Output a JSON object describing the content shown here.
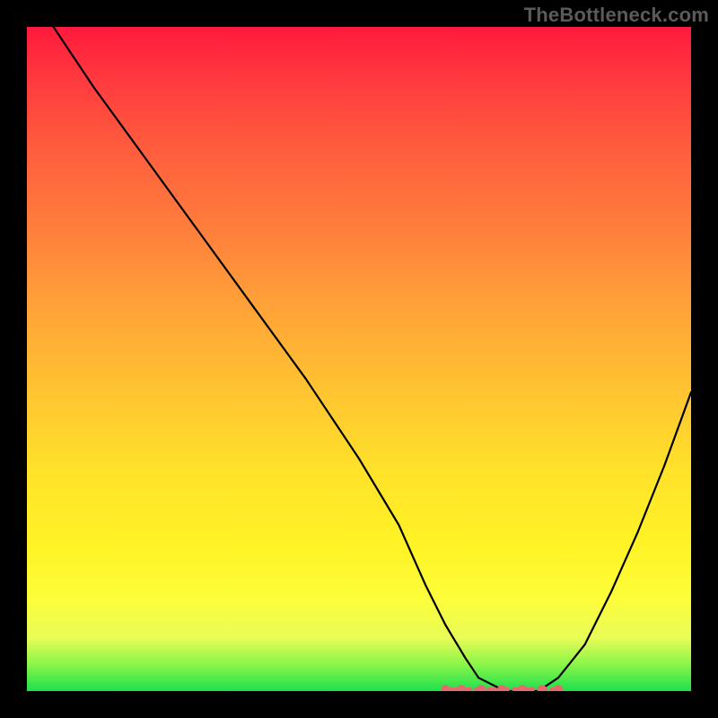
{
  "watermark": "TheBottleneck.com",
  "colors": {
    "background_black": "#000000",
    "gradient_top": "#ff1a3c",
    "gradient_mid": "#ffe22a",
    "gradient_bottom": "#1de04e",
    "curve_stroke": "#000000",
    "highlight_red": "#e46a6b"
  },
  "chart_data": {
    "type": "line",
    "title": "",
    "xlabel": "",
    "ylabel": "",
    "xlim": [
      0,
      100
    ],
    "ylim": [
      0,
      100
    ],
    "series": [
      {
        "name": "bottleneck-curve",
        "x": [
          0,
          4,
          10,
          18,
          26,
          34,
          42,
          50,
          56,
          60,
          63,
          66,
          68,
          70,
          72,
          74,
          77,
          80,
          84,
          88,
          92,
          96,
          100
        ],
        "values": [
          107,
          100,
          91,
          80,
          69,
          58,
          47,
          35,
          25,
          16,
          10,
          5,
          2,
          1,
          0,
          0,
          0,
          2,
          7,
          15,
          24,
          34,
          45
        ]
      }
    ],
    "annotations": [
      {
        "kind": "highlight-flat",
        "x_start": 63,
        "x_end": 80,
        "y": 0
      }
    ]
  }
}
